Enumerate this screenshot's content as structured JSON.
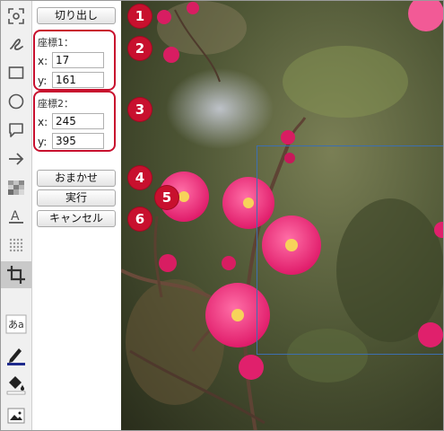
{
  "actions": {
    "cutout": "切り出し",
    "auto": "おまかせ",
    "run": "実行",
    "cancel": "キャンセル"
  },
  "coord1": {
    "title": "座標1：",
    "x_label": "x:",
    "y_label": "y:",
    "x": "17",
    "y": "161"
  },
  "coord2": {
    "title": "座標2：",
    "x_label": "x:",
    "y_label": "y:",
    "x": "245",
    "y": "395"
  },
  "callouts": [
    "1",
    "2",
    "3",
    "4",
    "5",
    "6"
  ],
  "toolbar": {
    "items": [
      "screenshot-region-icon",
      "freehand-icon",
      "rectangle-icon",
      "ellipse-icon",
      "speech-bubble-icon",
      "arrow-icon",
      "mosaic-icon",
      "text-underline-icon",
      "dots-icon",
      "crop-icon",
      "text-font-icon",
      "pen-icon",
      "fill-bucket-icon",
      "image-icon"
    ],
    "active": "crop-icon",
    "text_font_glyph": "あa",
    "text_underline_glyph": "A"
  },
  "colors": {
    "accent_red": "#c8102e",
    "crop_border": "#3d6fb0",
    "pen_color": "#1e2a8c"
  }
}
